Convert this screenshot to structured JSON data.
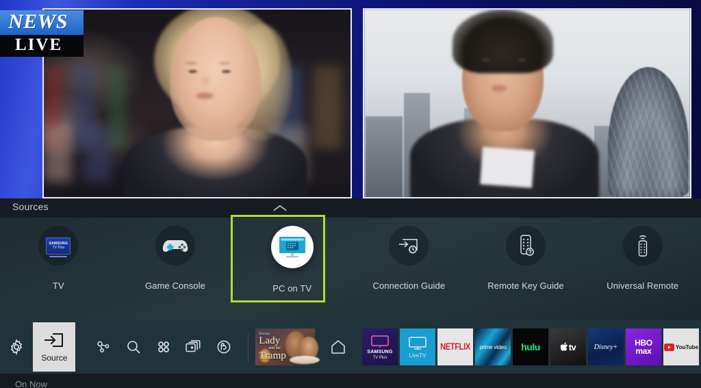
{
  "broadcast": {
    "bug_line1": "NEWS",
    "bug_line2": "LIVE"
  },
  "sources_panel": {
    "title": "Sources",
    "collapse_indicator": "chevron-up",
    "items": [
      {
        "label": "TV",
        "icon": "samsung-tv-plus-icon",
        "selected": false,
        "tv_plus_line1": "SAMSUNG",
        "tv_plus_line2": "TV Plus"
      },
      {
        "label": "Game Console",
        "icon": "gamepad-icon",
        "selected": false
      },
      {
        "label": "PC on TV",
        "icon": "monitor-icon",
        "selected": true
      },
      {
        "label": "Connection Guide",
        "icon": "connection-guide-icon",
        "selected": false
      },
      {
        "label": "Remote Key Guide",
        "icon": "remote-key-guide-icon",
        "selected": false
      },
      {
        "label": "Universal Remote",
        "icon": "universal-remote-icon",
        "selected": false
      }
    ],
    "highlight_color": "#b2de2e"
  },
  "taskbar": {
    "settings_icon": "gear-icon",
    "source_tile": {
      "label": "Source",
      "icon": "source-arrow-icon",
      "active": true
    },
    "quick_icons": [
      {
        "name": "ambient-network-icon"
      },
      {
        "name": "search-icon"
      },
      {
        "name": "apps-grid-icon"
      },
      {
        "name": "multi-view-add-icon"
      },
      {
        "name": "bixby-universe-icon"
      }
    ],
    "featured": {
      "name": "lady-and-the-tramp-tile",
      "studio": "Disney",
      "title_line1": "Lady",
      "title_connector": "and the",
      "title_line2": "Tramp"
    },
    "home_icon": "home-icon",
    "apps": [
      {
        "name": "samsung-tv-plus",
        "line1": "SAMSUNG",
        "line2": "TV Plus",
        "color": "#1b1347"
      },
      {
        "name": "livetv",
        "label": "LiveTV",
        "color": "#1a9dd0"
      },
      {
        "name": "netflix",
        "label": "NETFLIX",
        "color": "#e6e6e6"
      },
      {
        "name": "prime-video",
        "label": "prime video",
        "color": "#17a5d6"
      },
      {
        "name": "hulu",
        "label": "hulu",
        "color": "#070707"
      },
      {
        "name": "apple-tv",
        "label": "tv",
        "color": "#101010"
      },
      {
        "name": "disney-plus",
        "label": "Disney+",
        "color": "#0a1f4d"
      },
      {
        "name": "hbo-max",
        "label_line1": "HBO",
        "label_line2": "max",
        "color": "#5c0fb3"
      },
      {
        "name": "youtube",
        "label": "YouTube",
        "color": "#e3e3e3"
      }
    ]
  },
  "bottom_strip": {
    "label": "On Now"
  }
}
